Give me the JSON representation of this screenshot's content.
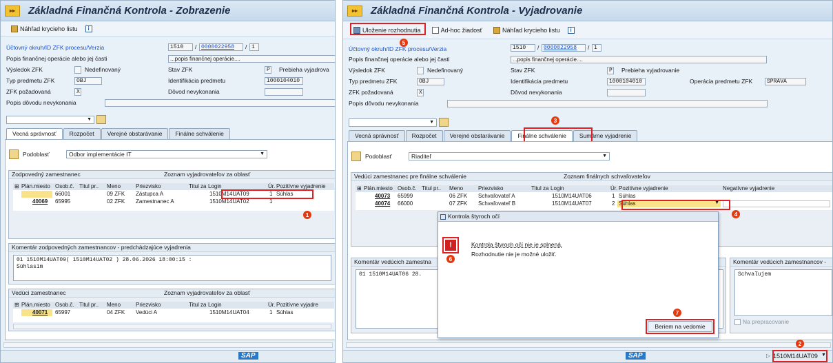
{
  "left": {
    "title": "Základná Finančná Kontrola - Zobrazenie",
    "toolbar": {
      "preview": "Náhľad krycieho listu"
    },
    "fields": {
      "okruh_label": "Účtovný okruh/ID ZFK procesu/Verzia",
      "okruh_a": "1510",
      "okruh_b": "0000022958",
      "okruh_c": "1",
      "popis_label": "Popis finančnej operácie alebo jej časti",
      "popis_value": "...popis finančnej operácie....",
      "vysledok_label": "Výsledok ZFK",
      "vysledok_value": "Nedefinovaný",
      "stav_label": "Stav ZFK",
      "stav_code": "P",
      "stav_value": "Prebieha vyjadrova",
      "typ_label": "Typ predmetu ZFK",
      "typ_value": "OBJ",
      "ident_label": "Identifikácia predmetu",
      "ident_value": "1000104010",
      "pozadovana_label": "ZFK požadovaná",
      "pozadovana_value": "X",
      "dovod_label": "Dôvod nevykonania",
      "popis_dovodu_label": "Popis dôvodu nevykonania"
    },
    "tabs": [
      "Vecná správnosť",
      "Rozpočet",
      "Verejné obstarávanie",
      "Finálne schválenie"
    ],
    "podoblast_label": "Podoblasť",
    "podoblast_value": "Odbor implementácie IT",
    "zodpovedny": {
      "header_left": "Zodpovedný zamestnanec",
      "header_right": "Zoznam vyjadrovateľov za oblasť",
      "columns": [
        "Plán.miesto",
        "Osob.č.",
        "Titul pr..",
        "Meno",
        "Priezvisko",
        "Titul za",
        "Login",
        "Úr.",
        "Pozitívne vyjadrenie"
      ],
      "rows": [
        {
          "plan": "",
          "osob": "66001",
          "titul": "",
          "meno": "09 ZFK",
          "priezvisko": "Zástupca A",
          "login": "1510M14UAT09",
          "ur": "1",
          "poz": "Súhlas"
        },
        {
          "plan": "40069",
          "osob": "65995",
          "titul": "",
          "meno": "02 ZFK",
          "priezvisko": "Zamestnanec A",
          "login": "1510M14UAT02",
          "ur": "1",
          "poz": ""
        }
      ]
    },
    "komentar": {
      "header": "Komentár zodpovedných zamestnancov - predchádzajúce vyjadrenia",
      "line1": "01 1510M14UAT09( 1510M14UAT02 ) 28.06.2026 18:00:15 :",
      "line2": "Súhlasím"
    },
    "veduci": {
      "header_left": "Vedúci zamestnanec",
      "header_right": "Zoznam vyjadrovateľov za oblasť",
      "columns": [
        "Plán.miesto",
        "Osob.č.",
        "Titul pr..",
        "Meno",
        "Priezvisko",
        "Titul za",
        "Login",
        "Úr.",
        "Pozitívne vyjadre"
      ],
      "rows": [
        {
          "plan": "40071",
          "osob": "65997",
          "meno": "04 ZFK",
          "priezvisko": "Vedúci A",
          "login": "1510M14UAT04",
          "ur": "1",
          "poz": "Súhlas"
        }
      ]
    },
    "badge1": "1"
  },
  "right": {
    "title": "Základná Finančná Kontrola - Vyjadrovanie",
    "toolbar": {
      "save": "Uloženie rozhodnutia",
      "adhoc": "Ad-hoc žiadosť",
      "preview": "Náhľad krycieho listu"
    },
    "fields": {
      "okruh_label": "Účtovný okruh/ID ZFK procesu/Verzia",
      "okruh_a": "1510",
      "okruh_b": "0000022958",
      "okruh_c": "1",
      "popis_label": "Popis finančnej operácie alebo jej časti",
      "popis_value": "...popis finančnej operácie....",
      "vysledok_label": "Výsledok ZFK",
      "vysledok_value": "Nedefinovaný",
      "stav_label": "Stav ZFK",
      "stav_code": "P",
      "stav_value": "Prebieha vyjadrovanie",
      "typ_label": "Typ predmetu ZFK",
      "typ_value": "OBJ",
      "ident_label": "Identifikácia predmetu",
      "ident_value": "1000104010",
      "operacia_label": "Operácia predmetu ZFK",
      "operacia_value": "SPRAVA",
      "pozadovana_label": "ZFK požadovaná",
      "pozadovana_value": "X",
      "dovod_label": "Dôvod nevykonania",
      "popis_dovodu_label": "Popis dôvodu nevykonania"
    },
    "tabs": [
      "Vecná správnosť",
      "Rozpočet",
      "Verejné obstarávanie",
      "Finálne schválenie",
      "Sumárne vyjadrenie"
    ],
    "podoblast_label": "Podoblasť",
    "podoblast_value": "Riaditeľ",
    "veduci_final": {
      "header_left": "Vedúci zamestnanec pre finálne schválenie",
      "header_right": "Zoznam finálnych schvaľovateľov",
      "columns": [
        "Plán.miesto",
        "Osob.č.",
        "Titul pr..",
        "Meno",
        "Priezvisko",
        "Titul za",
        "Login",
        "Úr.",
        "Pozitívne vyjadrenie",
        "Negatívne vyjadrenie"
      ],
      "rows": [
        {
          "plan": "40073",
          "osob": "65999",
          "meno": "06 ZFK",
          "priezvisko": "Schvaľovateľ A",
          "login": "1510M14UAT06",
          "ur": "1",
          "poz": "Súhlas"
        },
        {
          "plan": "40074",
          "osob": "66000",
          "meno": "07 ZFK",
          "priezvisko": "Schvaľovateľ B",
          "login": "1510M14UAT07",
          "ur": "2",
          "poz": "Súhlas"
        }
      ]
    },
    "komentar_left": {
      "header": "Komentár vedúcich zamestna",
      "line1": "01 1510M14UAT06 28."
    },
    "komentar_right": {
      "header": "Komentár vedúcich zamestnancov -",
      "text": "Schvaľujem",
      "checkbox": "Na prepracovanie"
    },
    "dialog": {
      "title": "Kontrola štyroch očí",
      "line1": "Kontrola štyroch očí nie je splnená.",
      "line2": "Rozhodnutie nie je možné uložiť.",
      "button": "Beriem na vedomie"
    },
    "status_user": "1510M14UAT09",
    "badges": {
      "b2": "2",
      "b3": "3",
      "b4": "4",
      "b5": "5",
      "b6": "6",
      "b7": "7"
    }
  },
  "sap_logo": "SAP",
  "colors": {
    "accent_red": "#e02020",
    "badge": "#e53a10",
    "link": "#1c55c8"
  }
}
